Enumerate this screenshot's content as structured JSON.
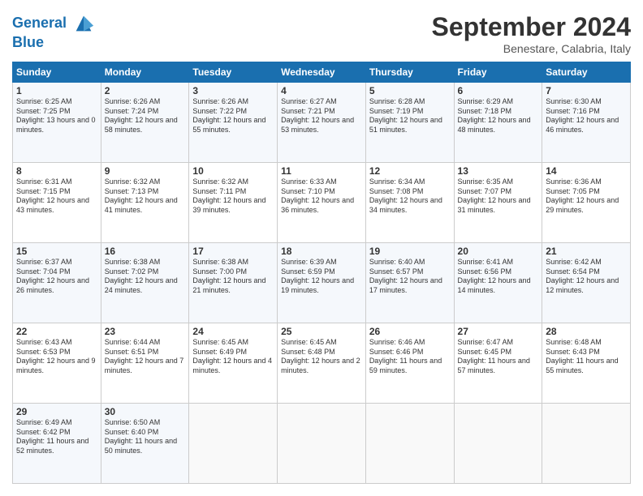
{
  "header": {
    "logo_line1": "General",
    "logo_line2": "Blue",
    "month_title": "September 2024",
    "location": "Benestare, Calabria, Italy"
  },
  "days_of_week": [
    "Sunday",
    "Monday",
    "Tuesday",
    "Wednesday",
    "Thursday",
    "Friday",
    "Saturday"
  ],
  "weeks": [
    [
      {
        "day": "1",
        "sunrise": "6:25 AM",
        "sunset": "7:25 PM",
        "daylight": "13 hours and 0 minutes."
      },
      {
        "day": "2",
        "sunrise": "6:26 AM",
        "sunset": "7:24 PM",
        "daylight": "12 hours and 58 minutes."
      },
      {
        "day": "3",
        "sunrise": "6:26 AM",
        "sunset": "7:22 PM",
        "daylight": "12 hours and 55 minutes."
      },
      {
        "day": "4",
        "sunrise": "6:27 AM",
        "sunset": "7:21 PM",
        "daylight": "12 hours and 53 minutes."
      },
      {
        "day": "5",
        "sunrise": "6:28 AM",
        "sunset": "7:19 PM",
        "daylight": "12 hours and 51 minutes."
      },
      {
        "day": "6",
        "sunrise": "6:29 AM",
        "sunset": "7:18 PM",
        "daylight": "12 hours and 48 minutes."
      },
      {
        "day": "7",
        "sunrise": "6:30 AM",
        "sunset": "7:16 PM",
        "daylight": "12 hours and 46 minutes."
      }
    ],
    [
      {
        "day": "8",
        "sunrise": "6:31 AM",
        "sunset": "7:15 PM",
        "daylight": "12 hours and 43 minutes."
      },
      {
        "day": "9",
        "sunrise": "6:32 AM",
        "sunset": "7:13 PM",
        "daylight": "12 hours and 41 minutes."
      },
      {
        "day": "10",
        "sunrise": "6:32 AM",
        "sunset": "7:11 PM",
        "daylight": "12 hours and 39 minutes."
      },
      {
        "day": "11",
        "sunrise": "6:33 AM",
        "sunset": "7:10 PM",
        "daylight": "12 hours and 36 minutes."
      },
      {
        "day": "12",
        "sunrise": "6:34 AM",
        "sunset": "7:08 PM",
        "daylight": "12 hours and 34 minutes."
      },
      {
        "day": "13",
        "sunrise": "6:35 AM",
        "sunset": "7:07 PM",
        "daylight": "12 hours and 31 minutes."
      },
      {
        "day": "14",
        "sunrise": "6:36 AM",
        "sunset": "7:05 PM",
        "daylight": "12 hours and 29 minutes."
      }
    ],
    [
      {
        "day": "15",
        "sunrise": "6:37 AM",
        "sunset": "7:04 PM",
        "daylight": "12 hours and 26 minutes."
      },
      {
        "day": "16",
        "sunrise": "6:38 AM",
        "sunset": "7:02 PM",
        "daylight": "12 hours and 24 minutes."
      },
      {
        "day": "17",
        "sunrise": "6:38 AM",
        "sunset": "7:00 PM",
        "daylight": "12 hours and 21 minutes."
      },
      {
        "day": "18",
        "sunrise": "6:39 AM",
        "sunset": "6:59 PM",
        "daylight": "12 hours and 19 minutes."
      },
      {
        "day": "19",
        "sunrise": "6:40 AM",
        "sunset": "6:57 PM",
        "daylight": "12 hours and 17 minutes."
      },
      {
        "day": "20",
        "sunrise": "6:41 AM",
        "sunset": "6:56 PM",
        "daylight": "12 hours and 14 minutes."
      },
      {
        "day": "21",
        "sunrise": "6:42 AM",
        "sunset": "6:54 PM",
        "daylight": "12 hours and 12 minutes."
      }
    ],
    [
      {
        "day": "22",
        "sunrise": "6:43 AM",
        "sunset": "6:53 PM",
        "daylight": "12 hours and 9 minutes."
      },
      {
        "day": "23",
        "sunrise": "6:44 AM",
        "sunset": "6:51 PM",
        "daylight": "12 hours and 7 minutes."
      },
      {
        "day": "24",
        "sunrise": "6:45 AM",
        "sunset": "6:49 PM",
        "daylight": "12 hours and 4 minutes."
      },
      {
        "day": "25",
        "sunrise": "6:45 AM",
        "sunset": "6:48 PM",
        "daylight": "12 hours and 2 minutes."
      },
      {
        "day": "26",
        "sunrise": "6:46 AM",
        "sunset": "6:46 PM",
        "daylight": "11 hours and 59 minutes."
      },
      {
        "day": "27",
        "sunrise": "6:47 AM",
        "sunset": "6:45 PM",
        "daylight": "11 hours and 57 minutes."
      },
      {
        "day": "28",
        "sunrise": "6:48 AM",
        "sunset": "6:43 PM",
        "daylight": "11 hours and 55 minutes."
      }
    ],
    [
      {
        "day": "29",
        "sunrise": "6:49 AM",
        "sunset": "6:42 PM",
        "daylight": "11 hours and 52 minutes."
      },
      {
        "day": "30",
        "sunrise": "6:50 AM",
        "sunset": "6:40 PM",
        "daylight": "11 hours and 50 minutes."
      },
      null,
      null,
      null,
      null,
      null
    ]
  ]
}
